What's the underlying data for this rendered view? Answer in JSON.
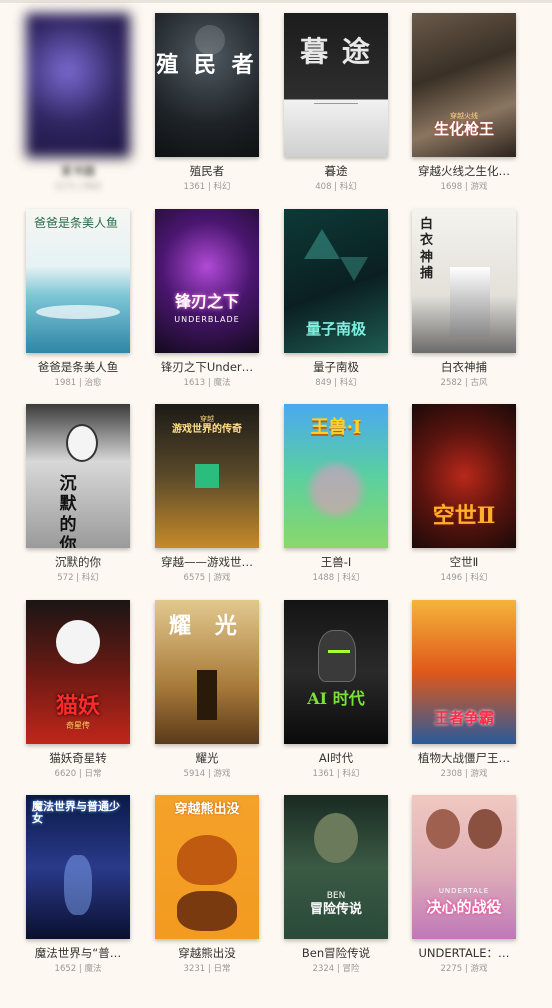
{
  "books": [
    {
      "title": "某书籍",
      "meta": "1171 | 科幻",
      "cover_text": "",
      "cover_sub": "",
      "blurred": true
    },
    {
      "title": "殖民者",
      "meta": "1361 | 科幻",
      "cover_text": "殖 民 者",
      "cover_sub": ""
    },
    {
      "title": "暮途",
      "meta": "408 | 科幻",
      "cover_text": "暮 途",
      "cover_sub": ""
    },
    {
      "title": "穿越火线之生化…",
      "meta": "1698 | 游戏",
      "cover_text": "生化枪王",
      "cover_sub": "穿越火线"
    },
    {
      "title": "爸爸是条美人鱼",
      "meta": "1981 | 治愈",
      "cover_text": "爸爸是条美人鱼",
      "cover_sub": ""
    },
    {
      "title": "锋刃之下Under…",
      "meta": "1613 | 魔法",
      "cover_text": "锋刃之下",
      "cover_sub": "UNDERBLADE"
    },
    {
      "title": "量子南极",
      "meta": "849 | 科幻",
      "cover_text": "量子南极",
      "cover_sub": ""
    },
    {
      "title": "白衣神捕",
      "meta": "2582 | 古风",
      "cover_text": "白衣神捕",
      "cover_sub": ""
    },
    {
      "title": "沉默的你",
      "meta": "572 | 科幻",
      "cover_text": "沉默的你",
      "cover_sub": ""
    },
    {
      "title": "穿越——游戏世…",
      "meta": "6575 | 游戏",
      "cover_text": "游戏世界的传奇",
      "cover_sub": "穿越"
    },
    {
      "title": "王兽-I",
      "meta": "1488 | 科幻",
      "cover_text": "王兽·I",
      "cover_sub": ""
    },
    {
      "title": "空世Ⅱ",
      "meta": "1496 | 科幻",
      "cover_text": "空世Ⅱ",
      "cover_sub": ""
    },
    {
      "title": "猫妖奇星转",
      "meta": "6620 | 日常",
      "cover_text": "猫妖",
      "cover_sub": "奇星传"
    },
    {
      "title": "耀光",
      "meta": "5914 | 游戏",
      "cover_text": "耀 光",
      "cover_sub": ""
    },
    {
      "title": "AI时代",
      "meta": "1361 | 科幻",
      "cover_text": "AI 时代",
      "cover_sub": ""
    },
    {
      "title": "植物大战僵尸王…",
      "meta": "2308 | 游戏",
      "cover_text": "王者争霸",
      "cover_sub": ""
    },
    {
      "title": "魔法世界与“普…",
      "meta": "1652 | 魔法",
      "cover_text": "魔法世界与普通少女",
      "cover_sub": ""
    },
    {
      "title": "穿越熊出没",
      "meta": "3231 | 日常",
      "cover_text": "穿越熊出没",
      "cover_sub": ""
    },
    {
      "title": "Ben冒险传说",
      "meta": "2324 | 冒险",
      "cover_text": "冒险传说",
      "cover_sub": "BEN"
    },
    {
      "title": "UNDERTALE：…",
      "meta": "2275 | 游戏",
      "cover_text": "决心的战役",
      "cover_sub": "UNDERTALE"
    }
  ],
  "colors": {
    "page_bg": "#fdf8f1",
    "title_text": "#333333",
    "meta_text": "#9a9a9a"
  }
}
